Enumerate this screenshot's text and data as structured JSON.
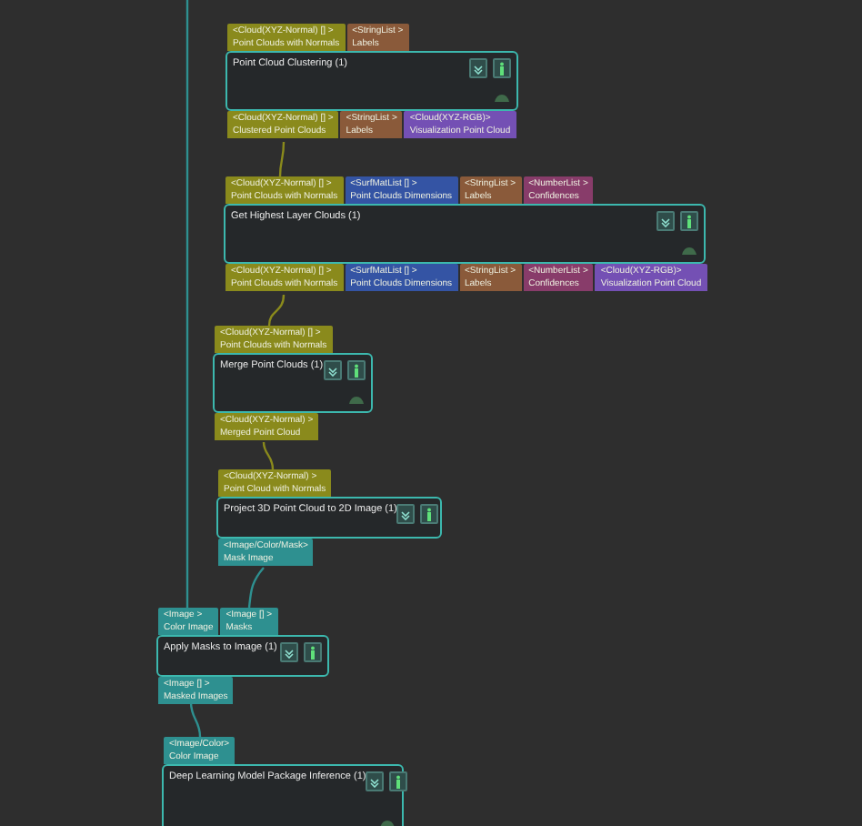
{
  "nodes": [
    {
      "title": "Point Cloud Clustering (1)",
      "idle_icon": true,
      "inputs": [
        {
          "type": "<Cloud(XYZ-Normal) [] >",
          "label": "Point Clouds with Normals",
          "color": "#8a8a1c"
        },
        {
          "type": "<StringList >",
          "label": "Labels",
          "color": "#8a5a3a"
        }
      ],
      "outputs": [
        {
          "type": "<Cloud(XYZ-Normal) [] >",
          "label": "Clustered Point Clouds",
          "color": "#8a8a1c"
        },
        {
          "type": "<StringList >",
          "label": "Labels",
          "color": "#8a5a3a"
        },
        {
          "type": "<Cloud(XYZ-RGB)>",
          "label": "Visualization Point Cloud",
          "color": "#7450b4"
        }
      ]
    },
    {
      "title": "Get Highest Layer Clouds (1)",
      "idle_icon": true,
      "inputs": [
        {
          "type": "<Cloud(XYZ-Normal) [] >",
          "label": "Point Clouds with Normals",
          "color": "#8a8a1c"
        },
        {
          "type": "<SurfMatList [] >",
          "label": "Point Clouds Dimensions",
          "color": "#3454a4"
        },
        {
          "type": "<StringList >",
          "label": "Labels",
          "color": "#8a5a3a"
        },
        {
          "type": "<NumberList >",
          "label": "Confidences",
          "color": "#883c6a"
        }
      ],
      "outputs": [
        {
          "type": "<Cloud(XYZ-Normal) [] >",
          "label": "Point Clouds with Normals",
          "color": "#8a8a1c"
        },
        {
          "type": "<SurfMatList [] >",
          "label": "Point Clouds Dimensions",
          "color": "#3454a4"
        },
        {
          "type": "<StringList >",
          "label": "Labels",
          "color": "#8a5a3a"
        },
        {
          "type": "<NumberList >",
          "label": "Confidences",
          "color": "#883c6a"
        },
        {
          "type": "<Cloud(XYZ-RGB)>",
          "label": "Visualization Point Cloud",
          "color": "#7450b4"
        }
      ]
    },
    {
      "title": "Merge Point Clouds (1)",
      "idle_icon": true,
      "inputs": [
        {
          "type": "<Cloud(XYZ-Normal) [] >",
          "label": "Point Clouds with Normals",
          "color": "#8a8a1c"
        }
      ],
      "outputs": [
        {
          "type": "<Cloud(XYZ-Normal) >",
          "label": "Merged Point Cloud",
          "color": "#8a8a1c"
        }
      ]
    },
    {
      "title": "Project 3D Point Cloud to 2D Image (1)",
      "idle_icon": false,
      "inputs": [
        {
          "type": "<Cloud(XYZ-Normal) >",
          "label": "Point Cloud with Normals",
          "color": "#8a8a1c"
        }
      ],
      "outputs": [
        {
          "type": "<Image/Color/Mask>",
          "label": "Mask Image",
          "color": "#2e9090"
        }
      ]
    },
    {
      "title": "Apply Masks to Image (1)",
      "idle_icon": false,
      "inputs": [
        {
          "type": "<Image >",
          "label": "Color Image",
          "color": "#2e9090"
        },
        {
          "type": "<Image [] >",
          "label": "Masks",
          "color": "#2e9090"
        }
      ],
      "outputs": [
        {
          "type": "<Image [] >",
          "label": "Masked Images",
          "color": "#2e9090"
        }
      ]
    },
    {
      "title": "Deep Learning Model Package Inference (1)",
      "idle_icon": true,
      "inputs": [
        {
          "type": "<Image/Color>",
          "label": "Color Image",
          "color": "#2e9090"
        }
      ]
    }
  ]
}
